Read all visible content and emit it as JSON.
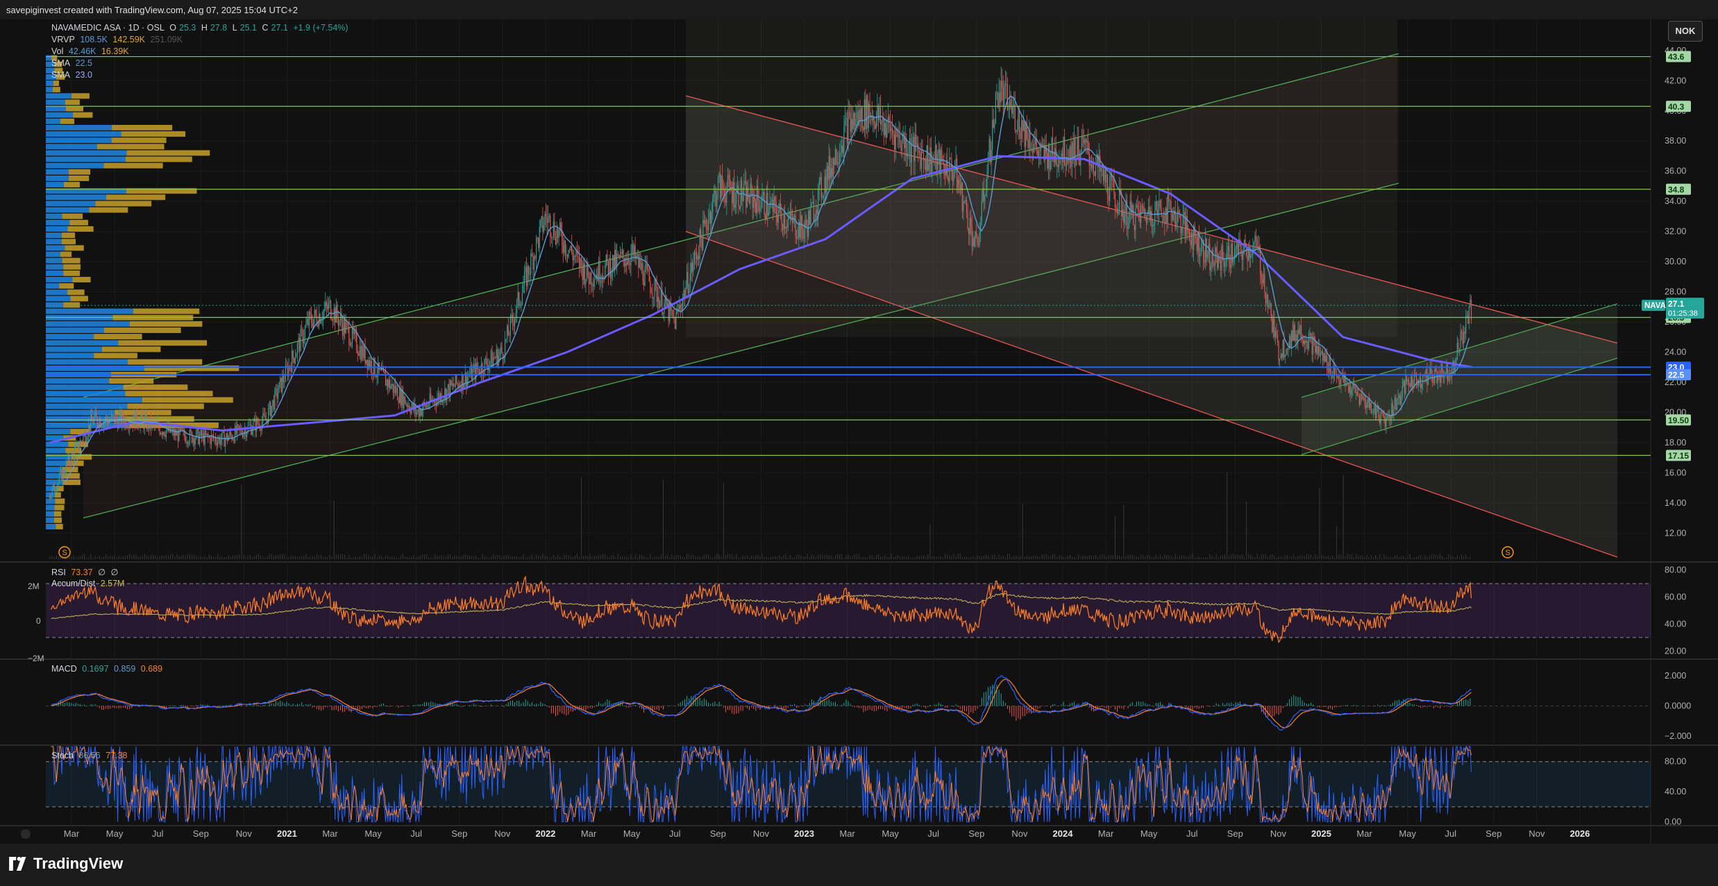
{
  "header": {
    "credit": "savepiginvest created with TradingView.com, Aug 07, 2025 15:04 UTC+2"
  },
  "currency_button": "NOK",
  "brand": "TradingView",
  "legend": {
    "symbol": "NAVAMEDIC ASA · 1D · OSL",
    "ohlc": {
      "o_label": "O",
      "o": "25.3",
      "h_label": "H",
      "h": "27.8",
      "l_label": "L",
      "l": "25.1",
      "c_label": "C",
      "c": "27.1",
      "change": "+1.9 (+7.54%)"
    },
    "vrvp": {
      "label": "VRVP",
      "v1": "108.5K",
      "v2": "142.59K",
      "v3": "251.09K"
    },
    "vol": {
      "label": "Vol",
      "v1": "42.46K",
      "v2": "16.39K"
    },
    "sma1": {
      "label": "SMA",
      "value": "22.5"
    },
    "sma2": {
      "label": "SMA",
      "value": "23.0"
    }
  },
  "rsi_legend": {
    "label": "RSI",
    "value": "73.37",
    "a": "∅",
    "b": "∅",
    "accum_label": "Accum/Dist",
    "accum_value": "2.57M"
  },
  "accum_axis": [
    "2M",
    "0",
    "−2M"
  ],
  "macd_legend": {
    "label": "MACD",
    "v1": "0.1697",
    "v2": "0.859",
    "v3": "0.689"
  },
  "stoch_legend": {
    "label": "Stoch",
    "v1": "86.56",
    "v2": "77.38"
  },
  "price_tag": {
    "symbol": "NAVA",
    "price": "27.1",
    "countdown": "01:25:38"
  },
  "colors": {
    "up": "#26a69a",
    "down": "#ef5350",
    "sma_fast": "#5b9bd5",
    "sma_slow": "#6a5cff",
    "vrvp_up": "#1e88e5",
    "vrvp_down": "#c8a02a"
  },
  "chart_data": [
    {
      "type": "candlestick",
      "title": "NAVAMEDIC ASA · 1D · OSL",
      "x_ticks": [
        "Mar",
        "May",
        "Jul",
        "Sep",
        "Nov",
        "2021",
        "Mar",
        "May",
        "Jul",
        "Sep",
        "Nov",
        "2022",
        "Mar",
        "May",
        "Jul",
        "Sep",
        "Nov",
        "2023",
        "Mar",
        "May",
        "Jul",
        "Sep",
        "Nov",
        "2024",
        "Mar",
        "May",
        "Jul",
        "Sep",
        "Nov",
        "2025",
        "Mar",
        "May",
        "Jul",
        "Sep",
        "Nov",
        "2026"
      ],
      "x_range": [
        "2020-02",
        "2026-02"
      ],
      "y_ticks": [
        "12.00",
        "14.00",
        "16.00",
        "18.00",
        "20.00",
        "22.00",
        "24.00",
        "26.00",
        "28.00",
        "30.00",
        "32.00",
        "34.00",
        "36.00",
        "38.00",
        "40.00",
        "42.00",
        "44.00"
      ],
      "ylim": [
        11.0,
        44.2
      ],
      "close_series": {
        "x": [
          "2020-02",
          "2020-04",
          "2020-06",
          "2020-08",
          "2020-10",
          "2020-12",
          "2021-02",
          "2021-03",
          "2021-05",
          "2021-07",
          "2021-09",
          "2021-11",
          "2022-01",
          "2022-03",
          "2022-05",
          "2022-07",
          "2022-09",
          "2022-11",
          "2023-01",
          "2023-03",
          "2023-04",
          "2023-06",
          "2023-08",
          "2023-09",
          "2023-10",
          "2023-12",
          "2024-02",
          "2024-04",
          "2024-06",
          "2024-08",
          "2024-10",
          "2024-11",
          "2024-12",
          "2025-02",
          "2025-04",
          "2025-05",
          "2025-07",
          "2025-08"
        ],
        "y": [
          14.5,
          19.5,
          19.5,
          18.5,
          18.2,
          19.5,
          26.0,
          27.0,
          23.0,
          20.0,
          22.0,
          24.0,
          33.0,
          29.0,
          30.5,
          26.0,
          35.0,
          34.0,
          32.0,
          39.0,
          40.0,
          37.5,
          36.0,
          30.8,
          41.5,
          37.0,
          37.5,
          33.0,
          33.5,
          30.0,
          31.0,
          24.0,
          25.5,
          22.0,
          19.5,
          22.0,
          22.8,
          27.1
        ]
      },
      "sma_slow": {
        "name": "SMA 23.0",
        "x": [
          "2020-02",
          "2020-06",
          "2020-10",
          "2021-02",
          "2021-06",
          "2021-10",
          "2022-02",
          "2022-06",
          "2022-10",
          "2023-02",
          "2023-06",
          "2023-10",
          "2024-02",
          "2024-06",
          "2024-10",
          "2025-02",
          "2025-06",
          "2025-08"
        ],
        "y": [
          18.0,
          19.4,
          18.8,
          19.3,
          19.8,
          22.0,
          24.0,
          26.5,
          29.5,
          31.5,
          35.5,
          37.0,
          36.8,
          34.5,
          30.5,
          25.0,
          23.5,
          23.0
        ]
      },
      "horizontal_levels": [
        43.6,
        40.3,
        34.8,
        26.3,
        23.0,
        22.5,
        19.5,
        17.15
      ],
      "level_labels": [
        "43.6",
        "40.3",
        "34.8",
        "26.3",
        "23.0",
        "22.5",
        "19.50",
        "17.15"
      ],
      "last_price": 27.1
    },
    {
      "type": "line",
      "title": "RSI",
      "value": 73.37,
      "y_ticks": [
        "20.00",
        "40.00",
        "60.00",
        "80.00"
      ],
      "ylim": [
        15,
        85
      ],
      "bands": [
        30,
        70
      ]
    },
    {
      "type": "line",
      "title": "MACD",
      "series": [
        {
          "name": "MACD",
          "last": 0.859
        },
        {
          "name": "Signal",
          "last": 0.689
        }
      ],
      "histogram_last": 0.1697,
      "y_ticks": [
        "−2.000",
        "0.0000",
        "2.000"
      ],
      "ylim": [
        -2.5,
        3.0
      ]
    },
    {
      "type": "line",
      "title": "Stoch",
      "series": [
        {
          "name": "%K",
          "last": 86.56
        },
        {
          "name": "%D",
          "last": 77.38
        }
      ],
      "y_ticks": [
        "0.00",
        "40.00",
        "80.00"
      ],
      "ylim": [
        -5,
        100
      ],
      "bands": [
        20,
        80
      ]
    }
  ]
}
